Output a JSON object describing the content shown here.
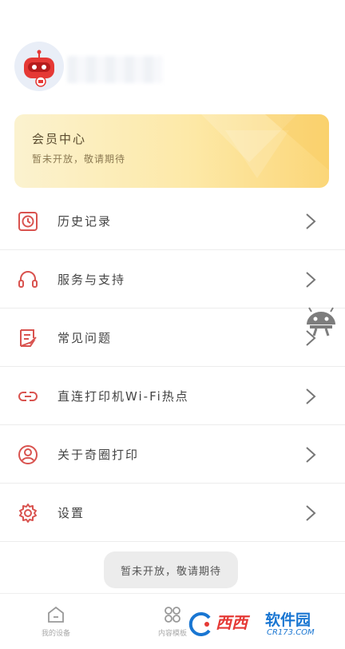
{
  "member": {
    "title": "会员中心",
    "subtitle": "暂未开放，敬请期待"
  },
  "menu": [
    {
      "label": "历史记录",
      "icon": "clock-icon"
    },
    {
      "label": "服务与支持",
      "icon": "headset-icon"
    },
    {
      "label": "常见问题",
      "icon": "faq-document-icon"
    },
    {
      "label": "直连打印机Wi-Fi热点",
      "icon": "link-icon"
    },
    {
      "label": "关于奇圈打印",
      "icon": "user-circle-icon"
    },
    {
      "label": "设置",
      "icon": "gear-icon"
    }
  ],
  "toast": "暂未开放，敬请期待",
  "tabs": [
    {
      "label": "我的设备"
    },
    {
      "label": "内容模板"
    }
  ],
  "watermark": {
    "brand": "西西",
    "name": "软件园",
    "url": "CR173.COM"
  },
  "colors": {
    "accent": "#d9534f",
    "card_start": "#fbf2cf",
    "card_end": "#fbd678"
  }
}
